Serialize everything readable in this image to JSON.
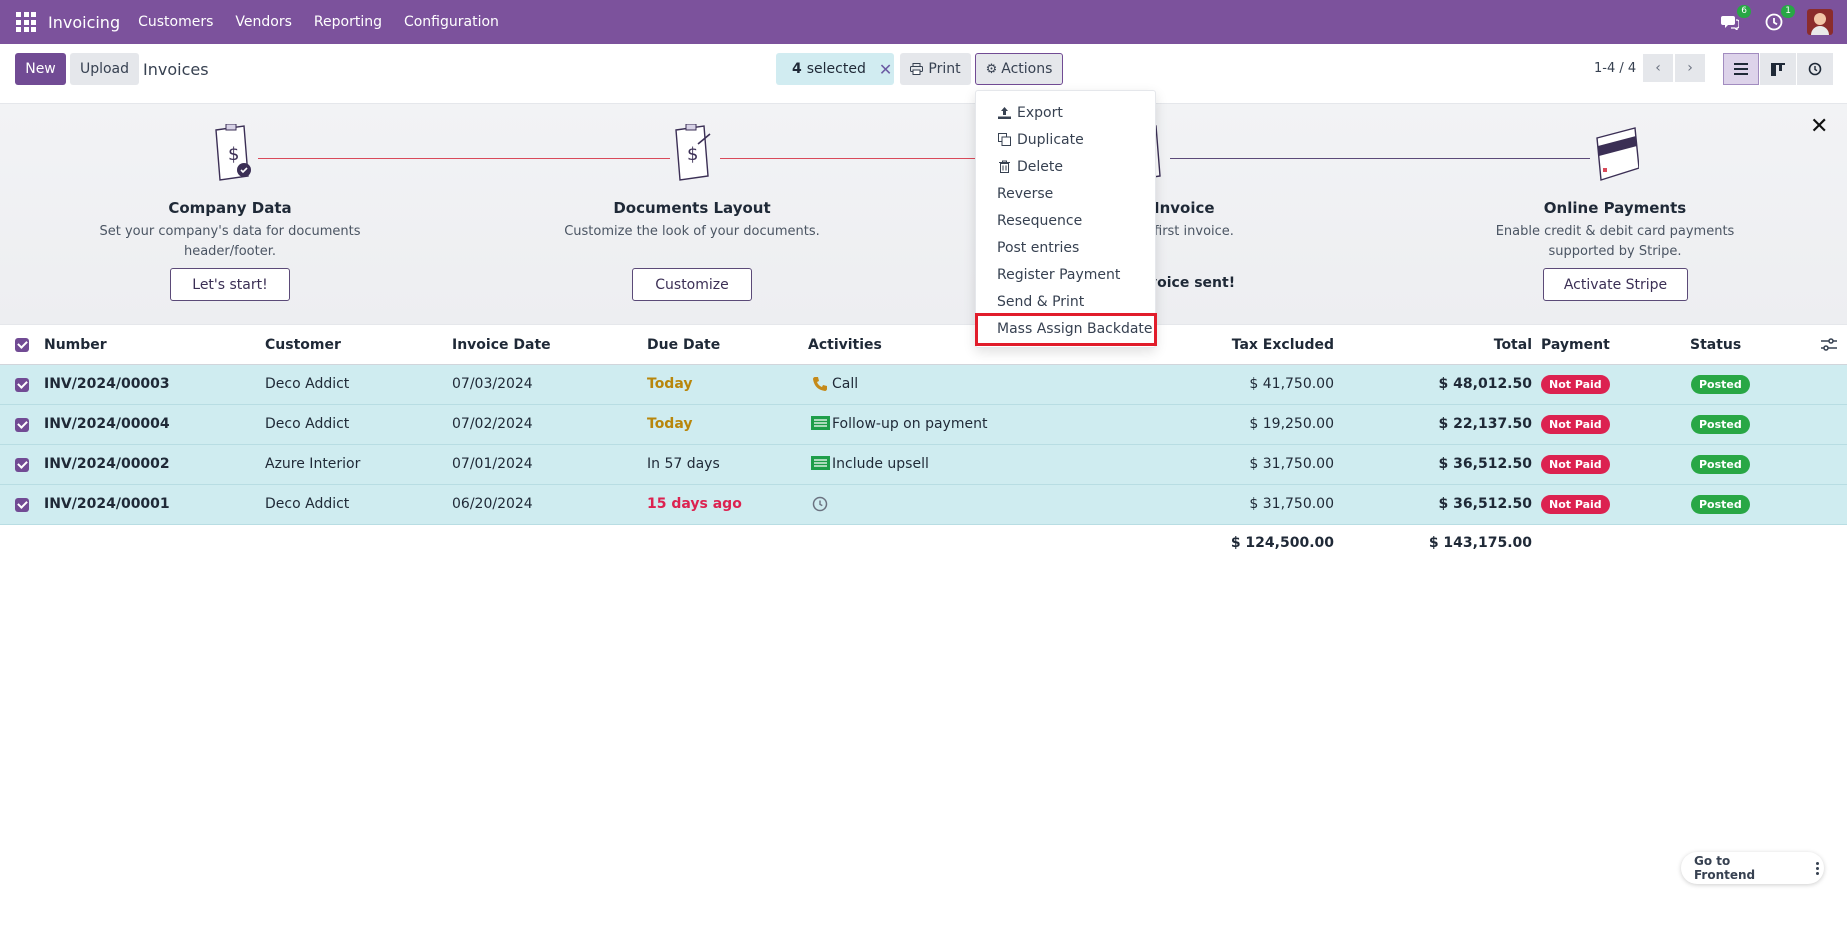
{
  "navbar": {
    "brand": "Invoicing",
    "menu": [
      "Customers",
      "Vendors",
      "Reporting",
      "Configuration"
    ],
    "messages_badge": "6",
    "activities_badge": "1",
    "icons": [
      "apps-grid-icon",
      "chat-icon",
      "clock-icon"
    ]
  },
  "control": {
    "new_label": "New",
    "upload_label": "Upload",
    "title": "Invoices",
    "selected_count": "4",
    "selected_label": "selected",
    "print_label": "Print",
    "actions_label": "Actions",
    "pager": "1-4 / 4"
  },
  "onboarding": {
    "steps": [
      {
        "title": "Company Data",
        "desc": "Set your company's data for documents header/footer.",
        "button": "Let's start!"
      },
      {
        "title": "Documents Layout",
        "desc": "Customize the look of your documents.",
        "button": "Customize"
      },
      {
        "title": "Invoice",
        "desc": "first invoice.",
        "button": "voice sent!"
      },
      {
        "title": "Online Payments",
        "desc": "Enable credit & debit card payments supported by Stripe.",
        "button": "Activate Stripe"
      }
    ]
  },
  "actions_menu": {
    "items": [
      "Export",
      "Duplicate",
      "Delete",
      "Reverse",
      "Resequence",
      "Post entries",
      "Register Payment",
      "Send & Print",
      "Mass Assign Backdate"
    ],
    "highlighted": "Mass Assign Backdate"
  },
  "table": {
    "columns": [
      "Number",
      "Customer",
      "Invoice Date",
      "Due Date",
      "Activities",
      "Tax Excluded",
      "Total",
      "Payment",
      "Status"
    ],
    "rows": [
      {
        "number": "INV/2024/00003",
        "customer": "Deco Addict",
        "invoice_date": "07/03/2024",
        "due_date": "Today",
        "activity": "Call",
        "tax_excluded": "$ 41,750.00",
        "total": "$ 48,012.50",
        "payment": "Not Paid",
        "status": "Posted"
      },
      {
        "number": "INV/2024/00004",
        "customer": "Deco Addict",
        "invoice_date": "07/02/2024",
        "due_date": "Today",
        "activity": "Follow-up on payment",
        "tax_excluded": "$ 19,250.00",
        "total": "$ 22,137.50",
        "payment": "Not Paid",
        "status": "Posted"
      },
      {
        "number": "INV/2024/00002",
        "customer": "Azure Interior",
        "invoice_date": "07/01/2024",
        "due_date": "In 57 days",
        "activity": "Include upsell",
        "tax_excluded": "$ 31,750.00",
        "total": "$ 36,512.50",
        "payment": "Not Paid",
        "status": "Posted"
      },
      {
        "number": "INV/2024/00001",
        "customer": "Deco Addict",
        "invoice_date": "06/20/2024",
        "due_date": "15 days ago",
        "activity": "",
        "tax_excluded": "$ 31,750.00",
        "total": "$ 36,512.50",
        "payment": "Not Paid",
        "status": "Posted"
      }
    ],
    "totals": {
      "tax_excluded": "$ 124,500.00",
      "total": "$ 143,175.00"
    }
  },
  "frontend_button": "Go to Frontend",
  "colors": {
    "navbar": "#7c529c",
    "primary": "#714b94",
    "row_selected": "#cfecf0",
    "not_paid": "#dc2250",
    "posted": "#28a745",
    "due_today": "#b8860b",
    "overdue": "#dc2250",
    "highlight_border": "#e11d2b"
  }
}
